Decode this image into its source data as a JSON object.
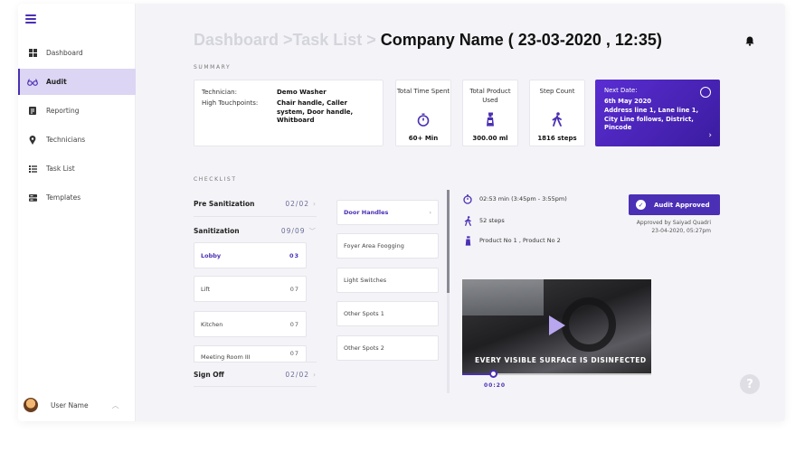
{
  "sidebar": {
    "items": [
      {
        "label": "Dashboard",
        "icon": "grid-icon"
      },
      {
        "label": "Audit",
        "icon": "glasses-icon"
      },
      {
        "label": "Reporting",
        "icon": "report-icon"
      },
      {
        "label": "Technicians",
        "icon": "pin-icon"
      },
      {
        "label": "Task List",
        "icon": "list-icon"
      },
      {
        "label": "Templates",
        "icon": "stack-icon"
      }
    ],
    "user_name": "User Name"
  },
  "header": {
    "crumb": "Dashboard >Task List > ",
    "title": "Company Name ( 23-03-2020 , 12:35)"
  },
  "summary": {
    "label": "SUMMARY",
    "technician_label": "Technician:",
    "technician_value": "Demo Washer",
    "touchpoints_label": "High Touchpoints:",
    "touchpoints_value": "Chair handle, Caller system, Door handle, Whitboard",
    "stats": [
      {
        "label": "Total Time Spent",
        "value": "60+ Min",
        "icon": "timer-icon"
      },
      {
        "label": "Total Product Used",
        "value": "300.00 ml",
        "icon": "spray-bottle-icon"
      },
      {
        "label": "Step Count",
        "value": "1816 steps",
        "icon": "walking-icon"
      }
    ],
    "next_date": {
      "title": "Next Date:",
      "date": "6th May 2020",
      "address": "Address line 1, Lane line 1, City Line follows, District, Pincode"
    }
  },
  "checklist": {
    "label": "CHECKLIST",
    "groups": [
      {
        "name": "Pre Sanitization",
        "count": "02/02"
      },
      {
        "name": "Sanitization",
        "count": "09/09"
      },
      {
        "name": "Sign Off",
        "count": "02/02"
      }
    ],
    "rooms": [
      {
        "name": "Lobby",
        "count": "03"
      },
      {
        "name": "Lift",
        "count": "07"
      },
      {
        "name": "Kitchen",
        "count": "07"
      },
      {
        "name": "Meeting Room III",
        "count": "07"
      }
    ],
    "spots": [
      "Door Handles",
      "Foyer Area Foogging",
      "Light Switches",
      "Other Spots 1",
      "Other Spots 2"
    ]
  },
  "details": {
    "time": "02:53 min (3:45pm - 3:55pm)",
    "steps": "52 steps",
    "products": "Product No 1 , Product No 2",
    "approved_label": "Audit Approved",
    "approved_by": "Approved by Saiyad Quadri",
    "approved_at": "23-04-2020, 05:27pm"
  },
  "video": {
    "caption": "EVERY VISIBLE SURFACE IS DISINFECTED",
    "time": "00:20",
    "progress": 0.16
  },
  "colors": {
    "accent": "#4b2fb4",
    "accent_light": "#dcd5f4"
  }
}
